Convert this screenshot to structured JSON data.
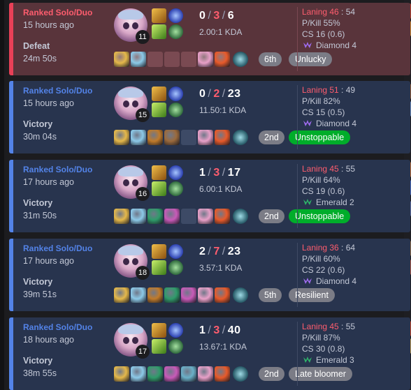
{
  "matches": [
    {
      "queue": "Ranked Solo/Duo",
      "time_ago": "15 hours ago",
      "result": "Defeat",
      "duration": "24m 50s",
      "level": "11",
      "kills": "0",
      "deaths": "3",
      "assists": "6",
      "kda_ratio": "2.00:1 KDA",
      "placement": "6th",
      "badge": "Unlucky",
      "badge_color": "grey",
      "laning_label": "Laning 46",
      "laning_opp": "54",
      "pkill": "P/Kill 55%",
      "cs": "CS 16 (0.6)",
      "rank": "Diamond 4",
      "rank_color": "#9f6cf0",
      "items": [
        "#e5b84a",
        "#8cc9e8",
        "empty",
        "empty",
        "empty",
        "#e8a0c8",
        "#e85a2a"
      ],
      "outcome": "loss"
    },
    {
      "queue": "Ranked Solo/Duo",
      "time_ago": "15 hours ago",
      "result": "Victory",
      "duration": "30m 04s",
      "level": "15",
      "kills": "0",
      "deaths": "2",
      "assists": "23",
      "kda_ratio": "11.50:1 KDA",
      "placement": "2nd",
      "badge": "Unstoppable",
      "badge_color": "green",
      "laning_label": "Laning 51",
      "laning_opp": "49",
      "pkill": "P/Kill 82%",
      "cs": "CS 15 (0.5)",
      "rank": "Diamond 4",
      "rank_color": "#9f6cf0",
      "items": [
        "#e5b84a",
        "#8cc9e8",
        "#c07a2a",
        "#9b6a3c",
        "empty",
        "#e8a0c8",
        "#e85a2a"
      ],
      "outcome": "win"
    },
    {
      "queue": "Ranked Solo/Duo",
      "time_ago": "17 hours ago",
      "result": "Victory",
      "duration": "31m 50s",
      "level": "16",
      "kills": "1",
      "deaths": "3",
      "assists": "17",
      "kda_ratio": "6.00:1 KDA",
      "placement": "2nd",
      "badge": "Unstoppable",
      "badge_color": "green",
      "laning_label": "Laning 45",
      "laning_opp": "55",
      "pkill": "P/Kill 64%",
      "cs": "CS 19 (0.6)",
      "rank": "Emerald 2",
      "rank_color": "#2fb36a",
      "items": [
        "#e5b84a",
        "#8cc9e8",
        "#2f9b6a",
        "#c85ab8",
        "empty",
        "#e8a0c8",
        "#e85a2a"
      ],
      "outcome": "win"
    },
    {
      "queue": "Ranked Solo/Duo",
      "time_ago": "17 hours ago",
      "result": "Victory",
      "duration": "39m 51s",
      "level": "18",
      "kills": "2",
      "deaths": "7",
      "assists": "23",
      "kda_ratio": "3.57:1 KDA",
      "placement": "5th",
      "badge": "Resilient",
      "badge_color": "grey",
      "laning_label": "Laning 36",
      "laning_opp": "64",
      "pkill": "P/Kill 60%",
      "cs": "CS 22 (0.6)",
      "rank": "Diamond 4",
      "rank_color": "#9f6cf0",
      "items": [
        "#e5b84a",
        "#8cc9e8",
        "#c07a2a",
        "#2f9b6a",
        "#c85ab8",
        "#e8a0c8",
        "#e85a2a"
      ],
      "outcome": "win"
    },
    {
      "queue": "Ranked Solo/Duo",
      "time_ago": "18 hours ago",
      "result": "Victory",
      "duration": "38m 55s",
      "level": "17",
      "kills": "1",
      "deaths": "3",
      "assists": "40",
      "kda_ratio": "13.67:1 KDA",
      "placement": "2nd",
      "badge": "Late bloomer",
      "badge_color": "grey",
      "laning_label": "Laning 45",
      "laning_opp": "55",
      "pkill": "P/Kill 87%",
      "cs": "CS 30 (0.8)",
      "rank": "Emerald 3",
      "rank_color": "#2fb36a",
      "items": [
        "#e5b84a",
        "#8cc9e8",
        "#2f9b6a",
        "#c85ab8",
        "#6ab0c8",
        "#e8a0c8",
        "#e85a2a"
      ],
      "outcome": "win"
    }
  ]
}
